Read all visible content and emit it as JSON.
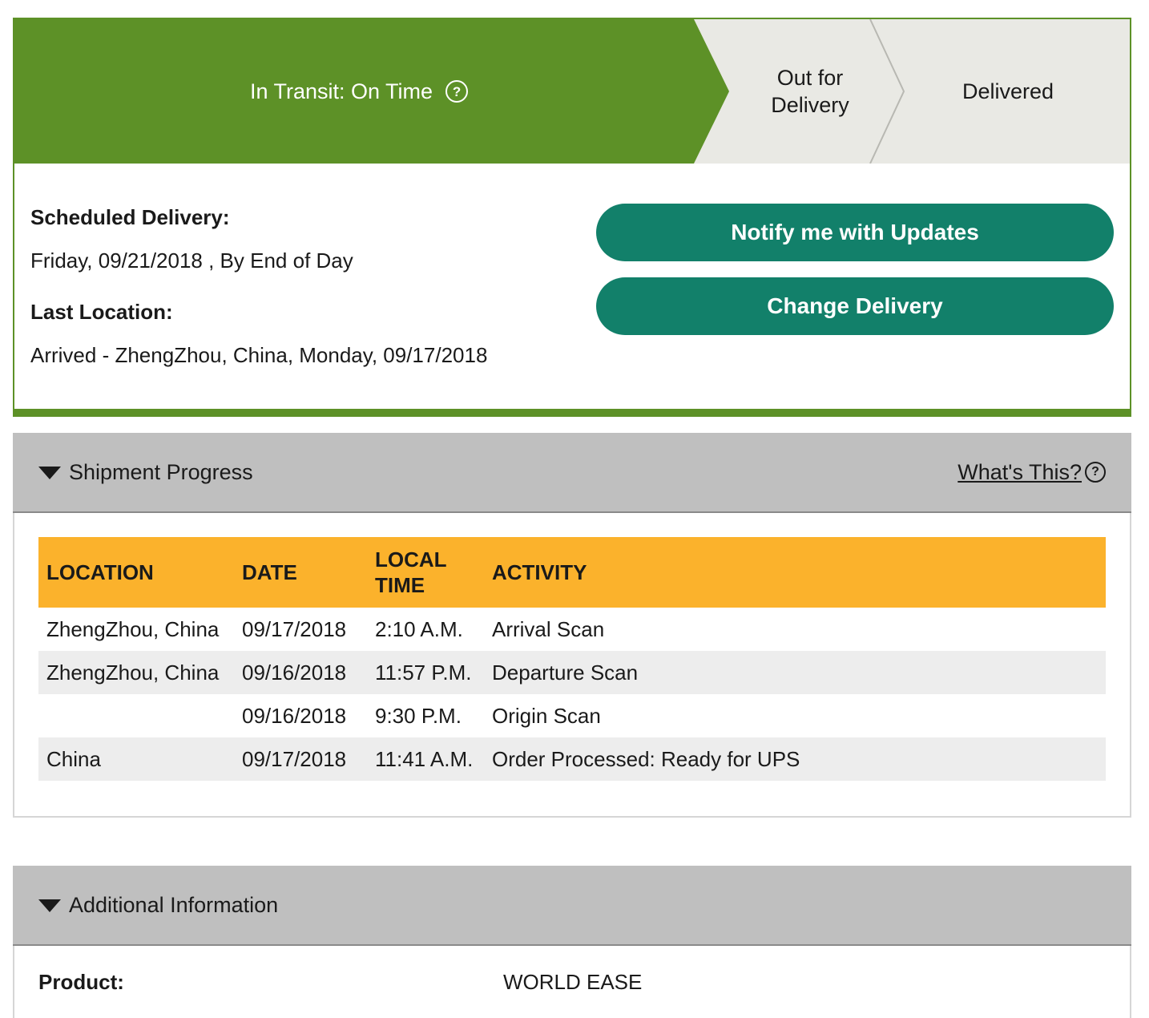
{
  "progress": {
    "current_step": "In Transit: On Time",
    "out_for_delivery_line1": "Out for",
    "out_for_delivery_line2": "Delivery",
    "delivered": "Delivered",
    "help_icon_glyph": "?",
    "active_color": "#5d9127",
    "inactive_color": "#e9e9e4"
  },
  "status": {
    "scheduled_label": "Scheduled Delivery:",
    "scheduled_value": "Friday, 09/21/2018 , By End of Day",
    "last_location_label": "Last Location:",
    "last_location_value": "Arrived - ZhengZhou, China, Monday, 09/17/2018"
  },
  "actions": {
    "notify_label": "Notify me with Updates",
    "change_label": "Change Delivery",
    "button_color": "#12806a"
  },
  "shipment_progress": {
    "title": "Shipment Progress",
    "whats_this": "What's This?",
    "help_icon_glyph": "?",
    "header_color": "#fbb22c",
    "columns": {
      "location": "LOCATION",
      "date": "DATE",
      "time_line1": "LOCAL",
      "time_line2": "TIME",
      "activity": "ACTIVITY"
    },
    "rows": [
      {
        "location": "ZhengZhou,  China",
        "date": "09/17/2018",
        "time": "2:10 A.M.",
        "activity": "Arrival Scan"
      },
      {
        "location": "ZhengZhou,  China",
        "date": "09/16/2018",
        "time": "11:57 P.M.",
        "activity": "Departure Scan"
      },
      {
        "location": "",
        "date": "09/16/2018",
        "time": "9:30 P.M.",
        "activity": "Origin Scan"
      },
      {
        "location": "China",
        "date": "09/17/2018",
        "time": "11:41 A.M.",
        "activity": "Order Processed: Ready for UPS"
      }
    ]
  },
  "additional_info": {
    "title": "Additional Information",
    "product_label": "Product:",
    "product_value": "WORLD EASE"
  }
}
